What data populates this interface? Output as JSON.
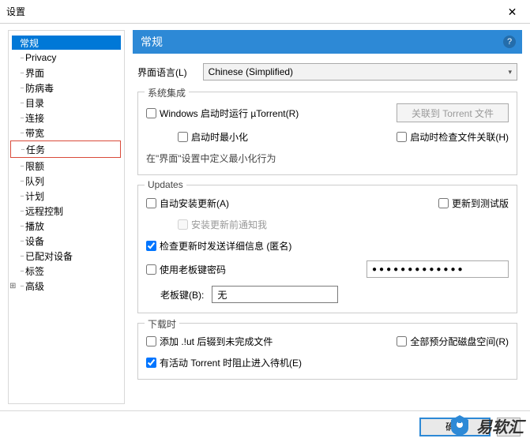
{
  "window": {
    "title": "设置"
  },
  "sidebar": {
    "items": [
      {
        "label": "常规",
        "selected": true
      },
      {
        "label": "Privacy"
      },
      {
        "label": "界面"
      },
      {
        "label": "防病毒"
      },
      {
        "label": "目录"
      },
      {
        "label": "连接"
      },
      {
        "label": "带宽"
      },
      {
        "label": "任务",
        "highlighted": true
      },
      {
        "label": "限额"
      },
      {
        "label": "队列"
      },
      {
        "label": "计划"
      },
      {
        "label": "远程控制"
      },
      {
        "label": "播放"
      },
      {
        "label": "设备"
      },
      {
        "label": "已配对设备"
      },
      {
        "label": "标签"
      },
      {
        "label": "高级",
        "expandable": true
      }
    ]
  },
  "panel": {
    "title": "常规",
    "language_label": "界面语言(L)",
    "language_value": "Chinese (Simplified)",
    "sys_integration": {
      "legend": "系统集成",
      "start_windows": "Windows 启动时运行 µTorrent(R)",
      "assoc_btn": "关联到 Torrent 文件",
      "minimize_start": "启动时最小化",
      "check_assoc": "启动时检查文件关联(H)",
      "note": "在\"界面\"设置中定义最小化行为"
    },
    "updates": {
      "legend": "Updates",
      "auto_install": "自动安装更新(A)",
      "beta": "更新到测试版",
      "notify": "安装更新前通知我",
      "anon": "检查更新时发送详细信息 (匿名)",
      "boss_pwd_label": "使用老板键密码",
      "pwd_value": "●●●●●●●●●●●●●",
      "boss_key_label": "老板键(B):",
      "boss_key_value": "无"
    },
    "download": {
      "legend": "下载时",
      "ut_ext": "添加 .!ut 后辍到未完成文件",
      "prealloc": "全部预分配磁盘空间(R)",
      "standby": "有活动 Torrent 时阻止进入待机(E)"
    }
  },
  "footer": {
    "ok": "确定"
  },
  "watermark": "易软汇"
}
